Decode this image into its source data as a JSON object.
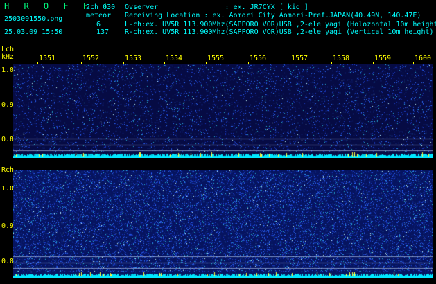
{
  "header": {
    "brand": "H R O F F T",
    "filename": "2503091550.png",
    "timestamp": "25.03.09 15:50",
    "mode": "2ch 030",
    "detect_label": "meteor",
    "count_l": "6",
    "count_r": "137",
    "observer": "Ovserver                : ex. JR7CYX [ kid ]",
    "location": "Receiving Location : ex. Aomori City Aomori-Pref.JAPAN(40.49N, 140.47E)",
    "lch_info": "L-ch:ex. UV5R 113.900Mhz(SAPPORO VOR)USB ,2-ele yagi (Holozontal 10m height)",
    "rch_info": "R-ch:ex. UV5R 113.900Mhz(SAPPORO VOR)USB ,2-ele yagi (Vertical 10m height)"
  },
  "lch": {
    "label": "Lch",
    "unit": "kHz"
  },
  "rch": {
    "label": "Rch"
  },
  "time_ticks": [
    "1551",
    "1552",
    "1553",
    "1554",
    "1555",
    "1556",
    "1557",
    "1558",
    "1559",
    "1600"
  ],
  "freq_ticks": [
    "1.0",
    "0.9",
    "0.8"
  ],
  "colors": {
    "label": "#ffff00",
    "text": "#ffffff",
    "brand": "#00ff80",
    "cyan": "#00ffff"
  }
}
